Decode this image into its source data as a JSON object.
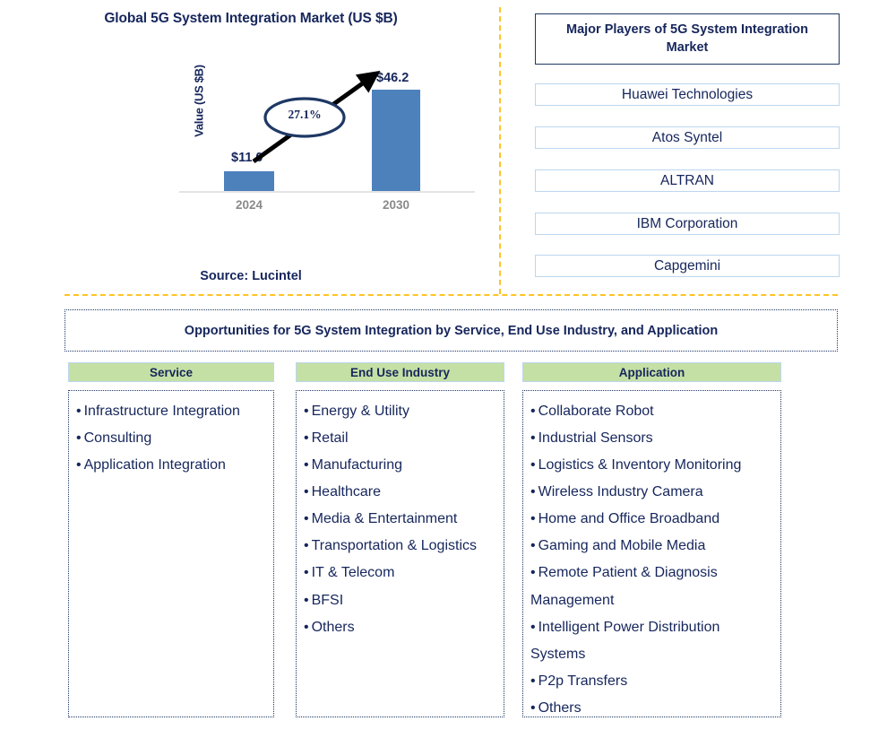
{
  "chart": {
    "title": "Global 5G System Integration Market (US $B)",
    "source": "Source: Lucintel"
  },
  "chart_data": {
    "type": "bar",
    "title": "Global 5G System Integration Market (US $B)",
    "categories": [
      "2024",
      "2030"
    ],
    "values": [
      11.0,
      46.2
    ],
    "value_labels": [
      "$11.0",
      "$46.2"
    ],
    "xlabel": "",
    "ylabel": "Value (US $B)",
    "ylim": [
      0,
      52
    ],
    "grid": false,
    "legend": null,
    "annotations": [
      {
        "text": "27.1%",
        "type": "cagr-callout",
        "note": "growth arrow from 2024 bar to 2030 bar"
      }
    ],
    "series_color": "#4d81bc",
    "source": "Source: Lucintel"
  },
  "players": {
    "header": "Major Players of 5G System Integration Market",
    "items": [
      "Huawei Technologies",
      "Atos Syntel",
      "ALTRAN",
      "IBM Corporation",
      "Capgemini"
    ]
  },
  "opportunities": {
    "banner": "Opportunities for 5G System Integration by Service, End Use Industry, and Application",
    "columns": [
      {
        "header": "Service",
        "items": [
          "Infrastructure Integration",
          "Consulting",
          "Application Integration"
        ]
      },
      {
        "header": "End Use Industry",
        "items": [
          "Energy & Utility",
          "Retail",
          "Manufacturing",
          "Healthcare",
          "Media & Entertainment",
          "Transportation & Logistics",
          "IT & Telecom",
          "BFSI",
          "Others"
        ]
      },
      {
        "header": "Application",
        "items": [
          "Collaborate Robot",
          "Industrial Sensors",
          "Logistics & Inventory Monitoring",
          "Wireless Industry Camera",
          "Home and Office Broadband",
          "Gaming and Mobile Media",
          "Remote Patient & Diagnosis Management",
          "Intelligent Power Distribution Systems",
          "P2p Transfers",
          "Others"
        ]
      }
    ]
  },
  "colors": {
    "bar": "#4d81bc",
    "navy": "#16265c",
    "divider": "#ffc425",
    "header_green": "#c5e0a5"
  }
}
